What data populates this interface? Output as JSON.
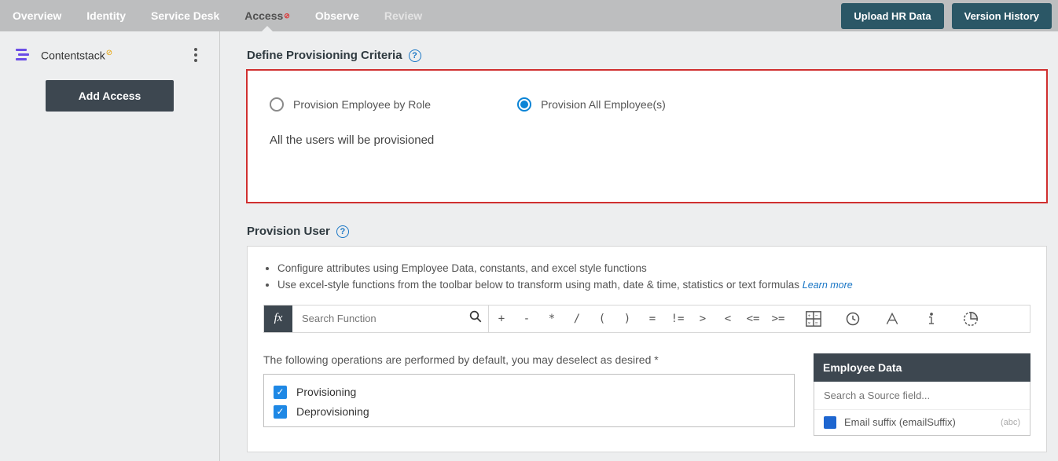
{
  "topnav": {
    "items": [
      {
        "label": "Overview"
      },
      {
        "label": "Identity"
      },
      {
        "label": "Service Desk"
      },
      {
        "label": "Access"
      },
      {
        "label": "Observe"
      },
      {
        "label": "Review"
      }
    ],
    "upload_btn": "Upload HR Data",
    "version_btn": "Version History"
  },
  "sidebar": {
    "app_name": "Contentstack",
    "add_access": "Add Access"
  },
  "criteria": {
    "title": "Define Provisioning Criteria",
    "opt_role": "Provision Employee by Role",
    "opt_all": "Provision All Employee(s)",
    "note": "All the users will be provisioned"
  },
  "provision": {
    "title": "Provision User",
    "bullet1": "Configure attributes using Employee Data, constants, and excel style functions",
    "bullet2": "Use excel-style functions from the toolbar below to transform using math, date & time, statistics or text formulas",
    "learn": "Learn more",
    "fx": "fx",
    "search_ph": "Search Function",
    "ops_note": "The following operations are performed by default, you may deselect as desired *",
    "chk1": "Provisioning",
    "chk2": "Deprovisioning"
  },
  "operators": [
    "+",
    "-",
    "*",
    "/",
    "(",
    ")",
    "=",
    "!=",
    ">",
    "<",
    "<=",
    ">="
  ],
  "employee": {
    "head": "Employee Data",
    "search_ph": "Search a Source field...",
    "item_label": "Email suffix (emailSuffix)",
    "item_type": "(abc)"
  }
}
